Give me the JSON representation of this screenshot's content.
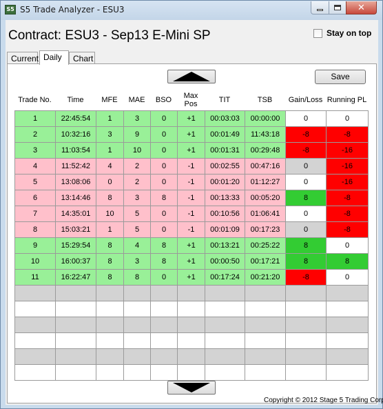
{
  "window": {
    "title": "S5 Trade Analyzer - ESU3",
    "icon": "s5-app-icon",
    "icon_text": "S5"
  },
  "header": {
    "contract": "Contract: ESU3 - Sep13 E-Mini SP",
    "stay_on_top": "Stay on top",
    "stay_on_top_checked": false
  },
  "tabs": [
    {
      "label": "Current"
    },
    {
      "label": "Daily",
      "active": true
    },
    {
      "label": "Chart"
    }
  ],
  "toolbar": {
    "save_label": "Save",
    "scroll_up_icon": "triangle-up-icon",
    "scroll_down_icon": "triangle-down-icon"
  },
  "table": {
    "columns": [
      "Trade No.",
      "Time",
      "MFE",
      "MAE",
      "BSO",
      "Max Pos",
      "TIT",
      "TSB",
      "Gain/Loss",
      "Running PL"
    ],
    "rows": [
      [
        "1",
        "22:45:54",
        "1",
        "3",
        "0",
        "+1",
        "00:03:03",
        "00:00:00",
        "0",
        "0"
      ],
      [
        "2",
        "10:32:16",
        "3",
        "9",
        "0",
        "+1",
        "00:01:49",
        "11:43:18",
        "-8",
        "-8"
      ],
      [
        "3",
        "11:03:54",
        "1",
        "10",
        "0",
        "+1",
        "00:01:31",
        "00:29:48",
        "-8",
        "-16"
      ],
      [
        "4",
        "11:52:42",
        "4",
        "2",
        "0",
        "-1",
        "00:02:55",
        "00:47:16",
        "0",
        "-16"
      ],
      [
        "5",
        "13:08:06",
        "0",
        "2",
        "0",
        "-1",
        "00:01:20",
        "01:12:27",
        "0",
        "-16"
      ],
      [
        "6",
        "13:14:46",
        "8",
        "3",
        "8",
        "-1",
        "00:13:33",
        "00:05:20",
        "8",
        "-8"
      ],
      [
        "7",
        "14:35:01",
        "10",
        "5",
        "0",
        "-1",
        "00:10:56",
        "01:06:41",
        "0",
        "-8"
      ],
      [
        "8",
        "15:03:21",
        "1",
        "5",
        "0",
        "-1",
        "00:01:09",
        "00:17:23",
        "0",
        "-8"
      ],
      [
        "9",
        "15:29:54",
        "8",
        "4",
        "8",
        "+1",
        "00:13:21",
        "00:25:22",
        "8",
        "0"
      ],
      [
        "10",
        "16:00:37",
        "8",
        "3",
        "8",
        "+1",
        "00:00:50",
        "00:17:21",
        "8",
        "8"
      ],
      [
        "11",
        "16:22:47",
        "8",
        "8",
        "0",
        "+1",
        "00:17:24",
        "00:21:20",
        "-8",
        "0"
      ]
    ],
    "row_styles": [
      "g",
      "g",
      "g",
      "p",
      "p",
      "p",
      "p",
      "p",
      "g",
      "g",
      "g"
    ],
    "gain_styles": [
      "w",
      "red",
      "red",
      "gr",
      "w",
      "grn",
      "w",
      "gr",
      "grn",
      "grn",
      "red"
    ],
    "running_styles": [
      "w",
      "red",
      "red",
      "red",
      "red",
      "red",
      "red",
      "red",
      "w",
      "grn",
      "w"
    ],
    "empty_rows": [
      "gr",
      "w",
      "gr",
      "w",
      "gr",
      "w"
    ],
    "colors": {
      "long_row": "#99f098",
      "short_row": "#ffc0cb",
      "loss": "#ff0000",
      "gain": "#33cc33",
      "flat": "#d3d3d3",
      "empty_alt": "#d3d3d3"
    }
  },
  "footer": {
    "copyright": "Copyright © 2012 Stage 5 Trading Corp."
  }
}
